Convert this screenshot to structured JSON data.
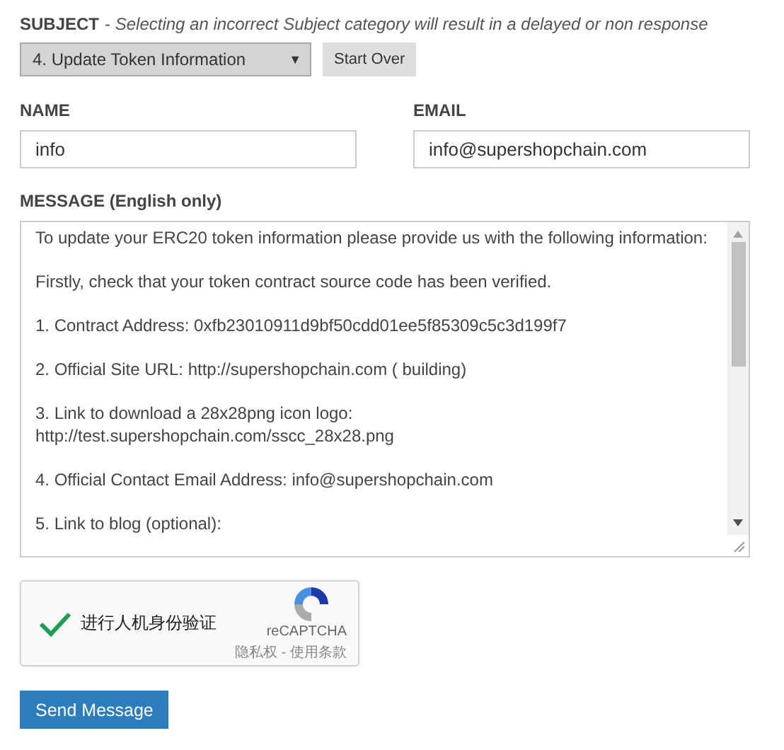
{
  "subject": {
    "label": "SUBJECT",
    "hint": "Selecting an incorrect Subject category will result in a delayed or non response",
    "separator": "-",
    "selected_option": "4. Update Token Information",
    "dropdown_icon": "▼",
    "reset_button": "Start Over"
  },
  "name": {
    "label": "NAME",
    "value": "info"
  },
  "email": {
    "label": "EMAIL",
    "value": "info@supershopchain.com"
  },
  "message": {
    "label": "MESSAGE (English only)",
    "paragraphs": [
      [
        "To update your ERC20 token information please provide us with the following information:"
      ],
      [
        "Firstly, check that your token contract source code has been verified."
      ],
      [
        "1. Contract Address: 0xfb23010911d9bf50cdd01ee5f85309c5c3d199f7"
      ],
      [
        "2. Official Site URL:  http://supershopchain.com  ( building)"
      ],
      [
        "3. Link to download a 28x28png icon logo:",
        "http://test.supershopchain.com/sscc_28x28.png"
      ],
      [
        "4. Official Contact Email Address:  info@supershopchain.com"
      ],
      [
        "5. Link to blog (optional):"
      ]
    ]
  },
  "captcha": {
    "checked": true,
    "label": "进行人机身份验证",
    "brand": "reCAPTCHA",
    "links": "隐私权 - 使用条款"
  },
  "submit_button": "Send Message"
}
